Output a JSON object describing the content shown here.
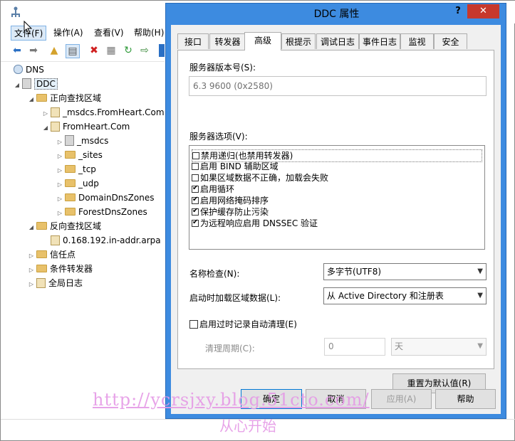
{
  "menu": [
    {
      "label": "文件(F)"
    },
    {
      "label": "操作(A)"
    },
    {
      "label": "查看(V)"
    },
    {
      "label": "帮助(H)"
    }
  ],
  "tree": {
    "root": "DNS",
    "server": "DDC",
    "forward_zones": "正向查找区域",
    "msdcs_zone": "_msdcs.FromHeart.Com",
    "fromheart_zone": "FromHeart.Com",
    "sub_msdcs": "_msdcs",
    "sub_sites": "_sites",
    "sub_tcp": "_tcp",
    "sub_udp": "_udp",
    "sub_domaindns": "DomainDnsZones",
    "sub_forestdns": "ForestDnsZones",
    "reverse_zones": "反向查找区域",
    "reverse_zone": "0.168.192.in-addr.arpa",
    "trust_points": "信任点",
    "cond_forwarders": "条件转发器",
    "global_logs": "全局日志"
  },
  "dialog": {
    "title": "DDC 属性",
    "help_glyph": "?",
    "close_glyph": "✕",
    "tabs": [
      {
        "label": "接口"
      },
      {
        "label": "转发器"
      },
      {
        "label": "高级"
      },
      {
        "label": "根提示"
      },
      {
        "label": "调试日志"
      },
      {
        "label": "事件日志"
      },
      {
        "label": "监视"
      },
      {
        "label": "安全"
      }
    ],
    "version_label": "服务器版本号(S):",
    "version_value": "6.3 9600 (0x2580)",
    "options_label": "服务器选项(V):",
    "options": [
      {
        "label": "禁用递归(也禁用转发器)",
        "checked": false
      },
      {
        "label": "启用 BIND 辅助区域",
        "checked": false
      },
      {
        "label": "如果区域数据不正确，加载会失败",
        "checked": false
      },
      {
        "label": "启用循环",
        "checked": true
      },
      {
        "label": "启用网络掩码排序",
        "checked": true
      },
      {
        "label": "保护缓存防止污染",
        "checked": true
      },
      {
        "label": "为远程响应启用 DNSSEC 验证",
        "checked": true
      }
    ],
    "name_check_label": "名称检查(N):",
    "name_check_value": "多字节(UTF8)",
    "load_zone_label": "启动时加载区域数据(L):",
    "load_zone_value": "从 Active Directory 和注册表",
    "scavenge_label": "启用过时记录自动清理(E)",
    "scavenge_checked": false,
    "period_label": "清理周期(C):",
    "period_value": "0",
    "period_unit": "天",
    "reset_button": "重置为默认值(R)",
    "ok_button": "确定",
    "cancel_button": "取消",
    "apply_button": "应用(A)",
    "help_button": "帮助"
  },
  "watermark": {
    "url": "http://ycrsjxy.blog.51cto.com/",
    "text": "从心开始"
  }
}
